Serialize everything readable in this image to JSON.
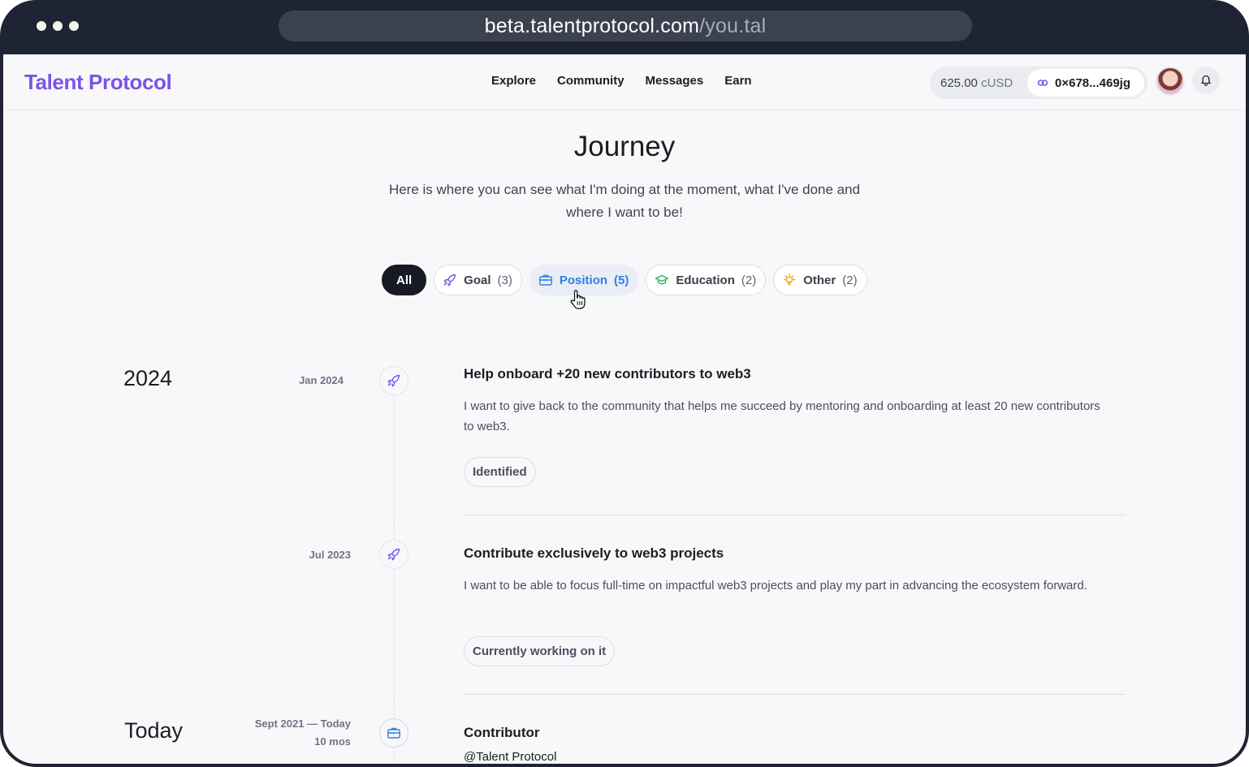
{
  "browser": {
    "url_host": "beta.talentprotocol.com",
    "url_path": "/you.tal"
  },
  "header": {
    "logo": "Talent Protocol",
    "nav": [
      "Explore",
      "Community",
      "Messages",
      "Earn"
    ],
    "balance_amount": "625.00",
    "balance_currency": "cUSD",
    "wallet_address": "0×678...469jg"
  },
  "page": {
    "title": "Journey",
    "subtitle": "Here is where you can see what I'm doing at the moment, what I've done and where I want to be!"
  },
  "filters": [
    {
      "label": "All",
      "count": "",
      "icon": "none"
    },
    {
      "label": "Goal",
      "count": "(3)",
      "icon": "rocket-icon"
    },
    {
      "label": "Position",
      "count": "(5)",
      "icon": "briefcase-icon"
    },
    {
      "label": "Education",
      "count": "(2)",
      "icon": "graduation-cap-icon"
    },
    {
      "label": "Other",
      "count": "(2)",
      "icon": "lightbulb-icon"
    }
  ],
  "colors": {
    "brand": "#7a55e6",
    "hover_accent": "#2f80e6",
    "education_icon": "#2fae5e",
    "other_icon": "#f0a418"
  },
  "timeline": {
    "years": [
      "2024",
      "Today"
    ],
    "entries": [
      {
        "date": "Jan 2024",
        "icon": "rocket-icon",
        "title": "Help onboard +20 new contributors to web3",
        "description": "I want to give back to the community that helps me succeed by mentoring and onboarding at least 20 new contributors to web3.",
        "status": "Identified"
      },
      {
        "date": "Jul 2023",
        "icon": "rocket-icon",
        "title": "Contribute exclusively to web3 projects",
        "description": "I want to be able to focus full-time on impactful web3 projects and play my part in advancing the ecosystem forward.",
        "status": "Currently working on it"
      },
      {
        "date": "Sept 2021 — Today",
        "duration": "10 mos",
        "icon": "briefcase-icon",
        "title": "Contributor",
        "subtitle": "@Talent Protocol"
      }
    ]
  }
}
